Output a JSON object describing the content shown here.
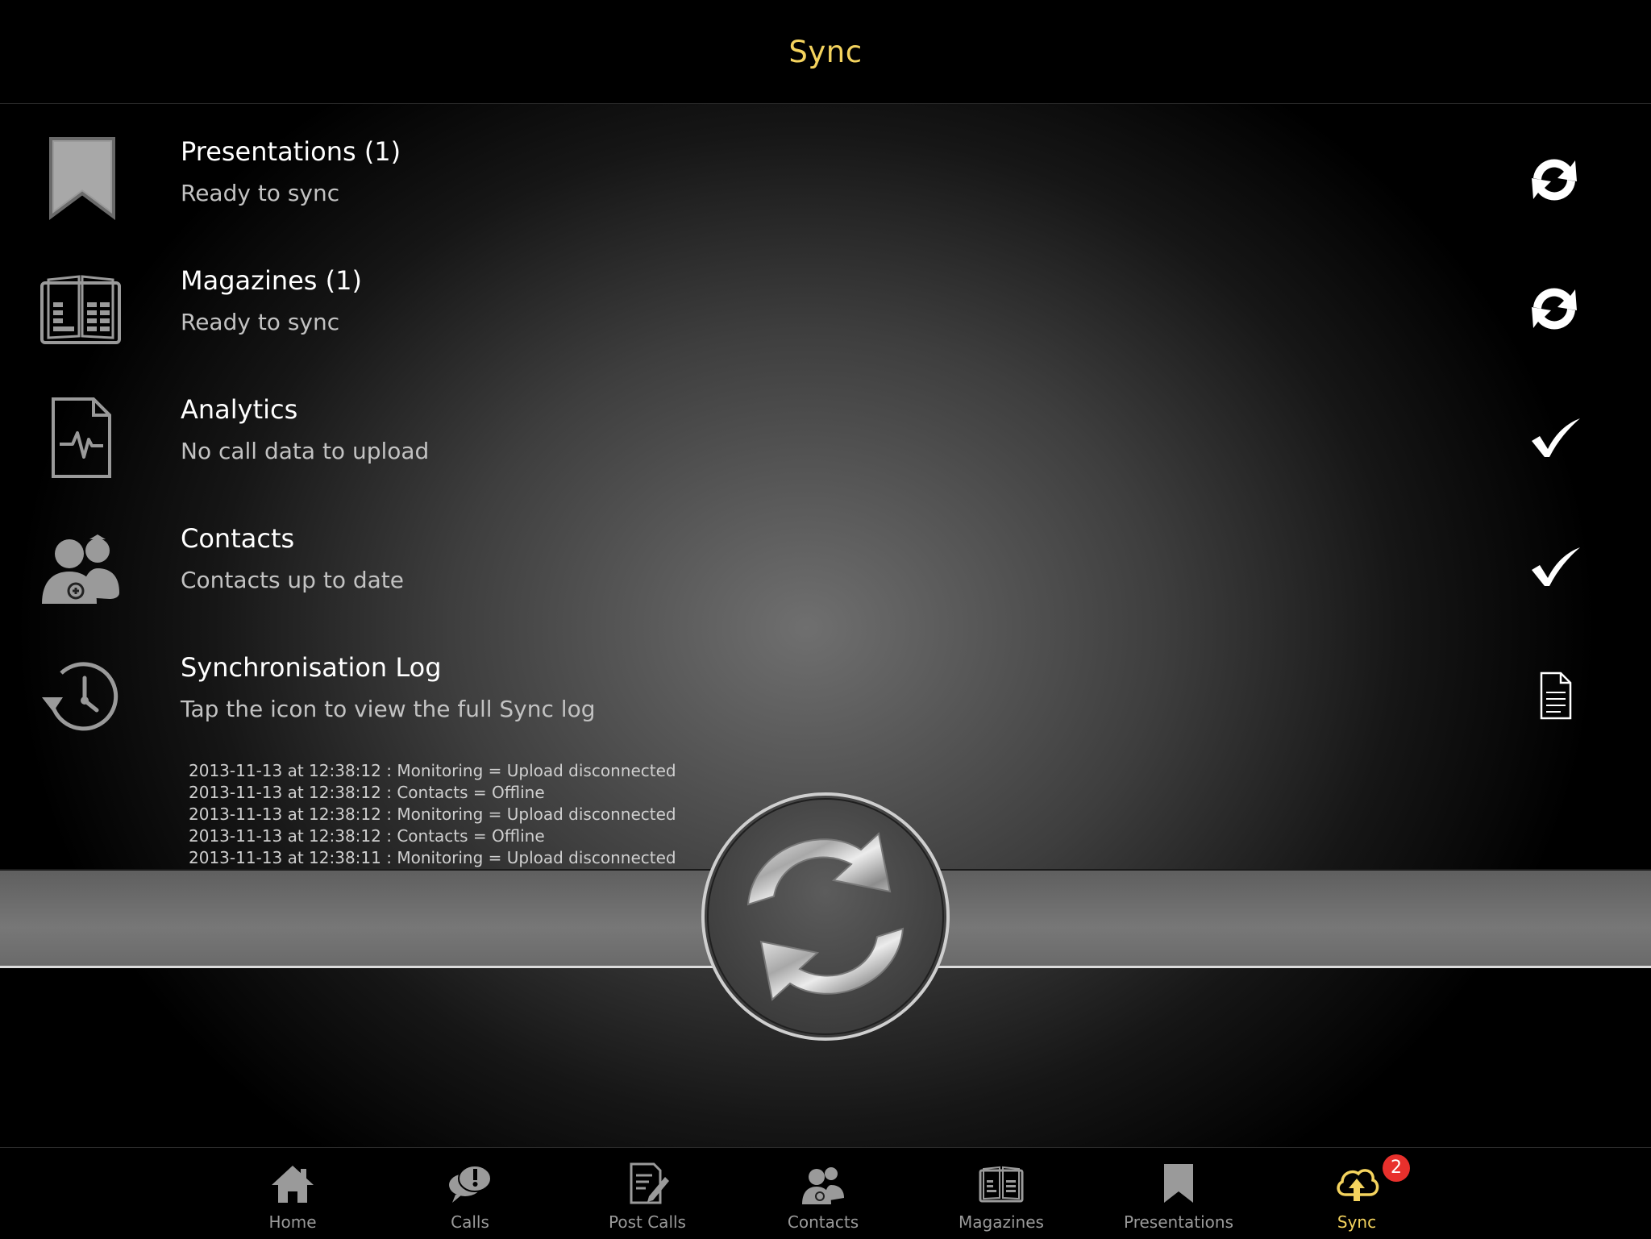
{
  "header": {
    "title": "Sync"
  },
  "rows": [
    {
      "title": "Presentations (1)",
      "subtitle": "Ready to sync",
      "icon": "bookmark-icon",
      "action_icon": "sync-arrows-icon"
    },
    {
      "title": "Magazines (1)",
      "subtitle": "Ready to sync",
      "icon": "magazine-icon",
      "action_icon": "sync-arrows-icon"
    },
    {
      "title": "Analytics",
      "subtitle": "No call data to upload",
      "icon": "analytics-document-icon",
      "action_icon": "checkmark-icon"
    },
    {
      "title": "Contacts",
      "subtitle": "Contacts up to date",
      "icon": "contacts-icon",
      "action_icon": "checkmark-icon"
    },
    {
      "title": "Synchronisation Log",
      "subtitle": "Tap the icon to view the full Sync log",
      "icon": "history-clock-icon",
      "action_icon": "document-icon"
    }
  ],
  "log": [
    "2013-11-13 at 12:38:12 : Monitoring = Upload disconnected",
    "2013-11-13 at 12:38:12 : Contacts = Offline",
    "2013-11-13 at 12:38:12 : Monitoring = Upload disconnected",
    "2013-11-13 at 12:38:12 : Contacts = Offline",
    "2013-11-13 at 12:38:11 : Monitoring = Upload disconnected"
  ],
  "tabs": [
    {
      "label": "Home",
      "icon": "home-icon"
    },
    {
      "label": "Calls",
      "icon": "chat-alert-icon"
    },
    {
      "label": "Post Calls",
      "icon": "edit-document-icon"
    },
    {
      "label": "Contacts",
      "icon": "contacts-icon"
    },
    {
      "label": "Magazines",
      "icon": "magazine-icon"
    },
    {
      "label": "Presentations",
      "icon": "bookmark-icon"
    },
    {
      "label": "Sync",
      "icon": "cloud-upload-icon",
      "badge": "2",
      "active": true
    }
  ],
  "colors": {
    "accent": "#f4d35e",
    "badge": "#e8302c",
    "background": "#000000"
  }
}
